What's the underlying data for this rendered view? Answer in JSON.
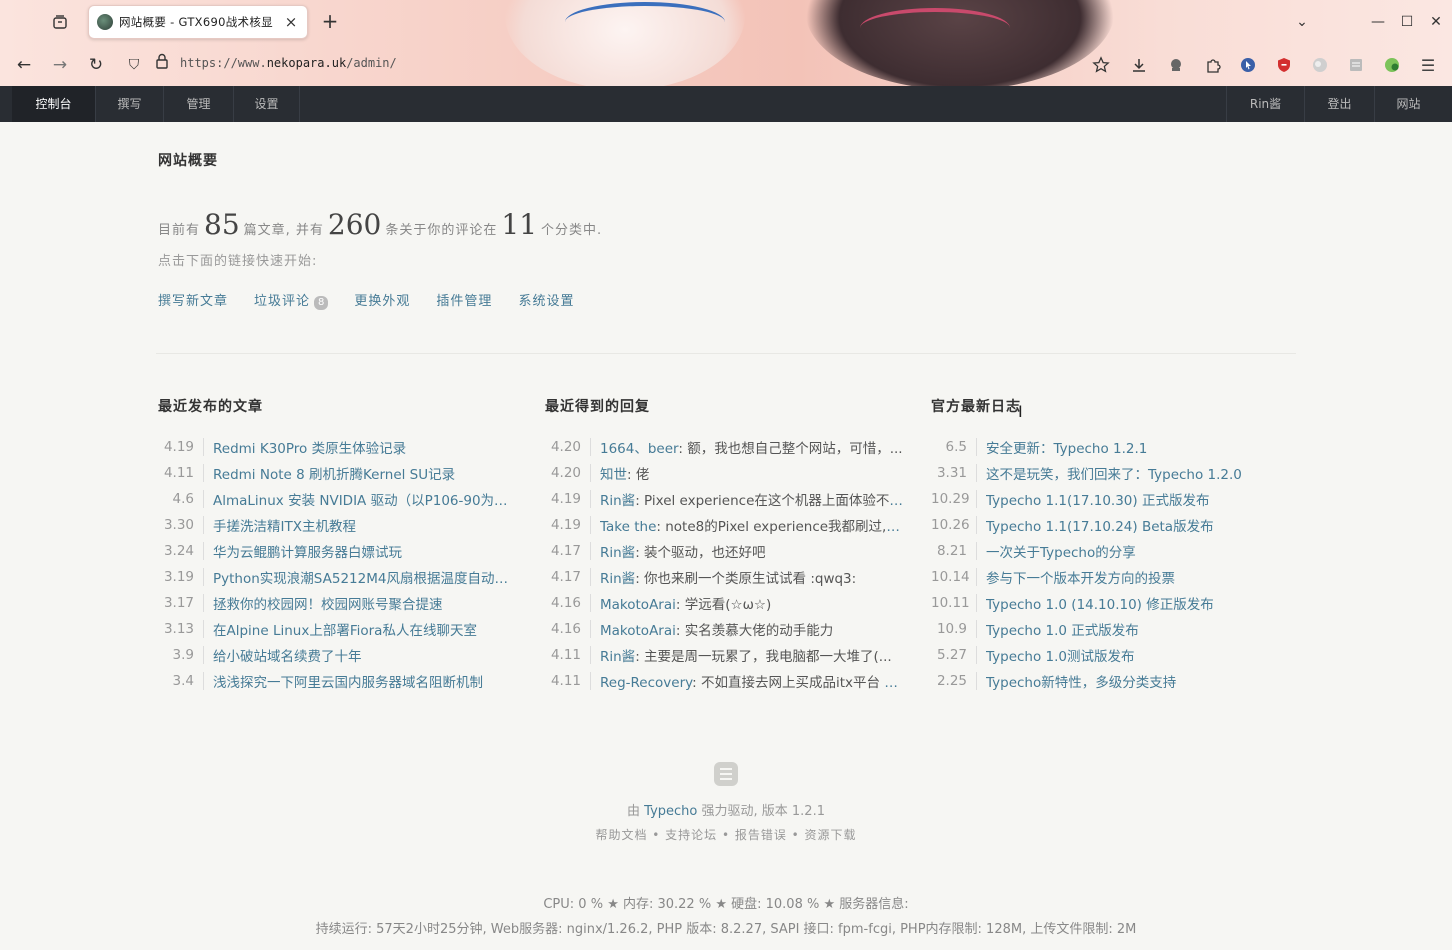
{
  "browser": {
    "tab_title": "网站概要 - GTX690战术核显",
    "url_prefix": "https://www.",
    "url_domain": "nekopara.uk",
    "url_path": "/admin/"
  },
  "nav": {
    "left": [
      "控制台",
      "撰写",
      "管理",
      "设置"
    ],
    "user": "Rin酱",
    "logout": "登出",
    "site": "网站"
  },
  "page": {
    "title": "网站概要",
    "summary_pre": "目前有",
    "posts_count": "85",
    "summary_mid1": "篇文章, 并有",
    "comments_count": "260",
    "summary_mid2": "条关于你的评论在",
    "categories_count": "11",
    "summary_post": "个分类中.",
    "hint": "点击下面的链接快速开始:",
    "quick_links": {
      "write": "撰写新文章",
      "spam": "垃圾评论",
      "spam_count": "8",
      "theme": "更换外观",
      "plugins": "插件管理",
      "settings": "系统设置"
    }
  },
  "recent_posts": {
    "heading": "最近发布的文章",
    "items": [
      {
        "date": "4.19",
        "title": "Redmi K30Pro 类原生体验记录"
      },
      {
        "date": "4.11",
        "title": "Redmi Note 8 刷机折腾Kernel SU记录"
      },
      {
        "date": "4.6",
        "title": "AlmaLinux 安装 NVIDIA 驱动（以P106-90为例）"
      },
      {
        "date": "3.30",
        "title": "手搓洗洁精ITX主机教程"
      },
      {
        "date": "3.24",
        "title": "华为云鲲鹏计算服务器白嫖试玩"
      },
      {
        "date": "3.19",
        "title": "Python实现浪潮SA5212M4风扇根据温度自动调节"
      },
      {
        "date": "3.17",
        "title": "拯救你的校园网！校园网账号聚合提速"
      },
      {
        "date": "3.13",
        "title": "在Alpine Linux上部署Fiora私人在线聊天室"
      },
      {
        "date": "3.9",
        "title": "给小破站域名续费了十年"
      },
      {
        "date": "3.4",
        "title": "浅浅探究一下阿里云国内服务器域名阻断机制"
      }
    ]
  },
  "recent_comments": {
    "heading": "最近得到的回复",
    "items": [
      {
        "date": "4.20",
        "author": "1664、beer",
        "text": "额，我也想自己整个网站，可惜，..."
      },
      {
        "date": "4.20",
        "author": "知世",
        "text": "佬"
      },
      {
        "date": "4.19",
        "author": "Rin酱",
        "text": "Pixel experience在这个机器上面体验不如..."
      },
      {
        "date": "4.19",
        "author": "Take the",
        "text": "note8的Pixel experience我都刷过,在上..."
      },
      {
        "date": "4.17",
        "author": "Rin酱",
        "text": "装个驱动，也还好吧"
      },
      {
        "date": "4.17",
        "author": "Rin酱",
        "text": "你也来刷一个类原生试试看 :qwq3:"
      },
      {
        "date": "4.16",
        "author": "MakotoArai",
        "text": "学远看(☆ω☆)"
      },
      {
        "date": "4.16",
        "author": "MakotoArai",
        "text": "实名羡慕大佬的动手能力"
      },
      {
        "date": "4.11",
        "author": "Rin酱",
        "text": "主要是周一玩累了，我电脑都一大堆了(..."
      },
      {
        "date": "4.11",
        "author": "Reg-Recovery",
        "text": "不如直接去网上买成品itx平台 配..."
      }
    ]
  },
  "official_logs": {
    "heading": "官方最新日志",
    "items": [
      {
        "date": "6.5",
        "title": "安全更新：Typecho 1.2.1"
      },
      {
        "date": "3.31",
        "title": "这不是玩笑，我们回来了：Typecho 1.2.0"
      },
      {
        "date": "10.29",
        "title": "Typecho 1.1(17.10.30) 正式版发布"
      },
      {
        "date": "10.26",
        "title": "Typecho 1.1(17.10.24) Beta版发布"
      },
      {
        "date": "8.21",
        "title": "一次关于Typecho的分享"
      },
      {
        "date": "10.14",
        "title": "参与下一个版本开发方向的投票"
      },
      {
        "date": "10.11",
        "title": "Typecho 1.0 (14.10.10) 修正版发布"
      },
      {
        "date": "10.9",
        "title": "Typecho 1.0 正式版发布"
      },
      {
        "date": "5.27",
        "title": "Typecho 1.0测试版发布"
      },
      {
        "date": "2.25",
        "title": "Typecho新特性，多级分类支持"
      }
    ]
  },
  "footer": {
    "powered_pre": "由",
    "powered_link": "Typecho",
    "powered_post": "强力驱动, 版本 1.2.1",
    "links": "帮助文档 • 支持论坛 • 报告错误 • 资源下载",
    "stats_line1": "CPU: 0 % ★ 内存: 30.22 % ★ 硬盘: 10.08 % ★ 服务器信息:",
    "stats_line2": "持续运行: 57天2小时25分钟, Web服务器: nginx/1.26.2, PHP 版本: 8.2.27, SAPI 接口: fpm-fcgi, PHP内存限制: 128M, 上传文件限制: 2M"
  }
}
